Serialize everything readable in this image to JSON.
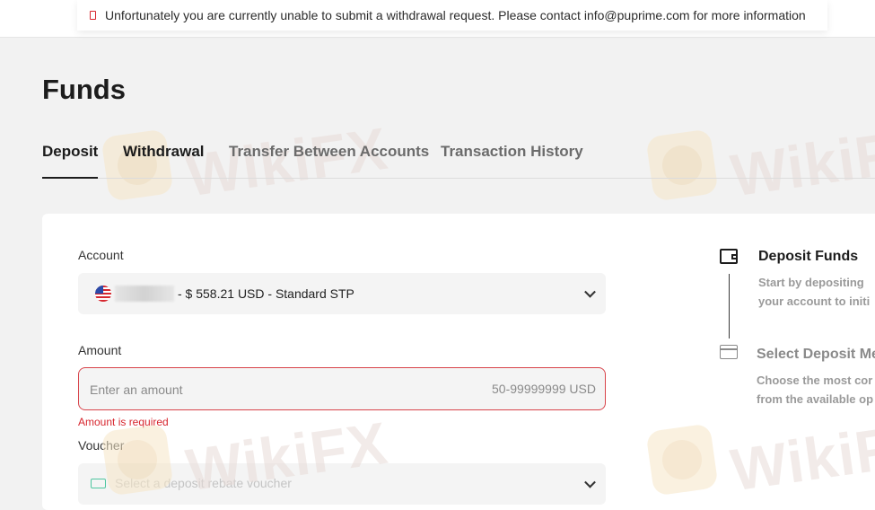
{
  "alert": {
    "message": "Unfortunately you are currently unable to submit a withdrawal request. Please contact info@puprime.com for more information",
    "icon": "alert-icon",
    "color": "#d7262e"
  },
  "page": {
    "title": "Funds"
  },
  "tabs": [
    {
      "label": "Deposit",
      "active": true
    },
    {
      "label": "Withdrawal",
      "active": false
    },
    {
      "label": "Transfer Between Accounts",
      "active": false
    },
    {
      "label": "Transaction History",
      "active": false
    }
  ],
  "form": {
    "account_label": "Account",
    "account_value": "- $ 558.21 USD - Standard STP",
    "amount_label": "Amount",
    "amount_placeholder": "Enter an amount",
    "amount_range": "50-99999999  USD",
    "amount_error": "Amount is required",
    "voucher_label": "Voucher",
    "voucher_placeholder": "Select a deposit rebate voucher"
  },
  "steps": [
    {
      "title": "Deposit Funds",
      "desc_line1": "Start by depositing",
      "desc_line2": "your account to initi",
      "icon": "wallet-icon"
    },
    {
      "title": "Select Deposit Me",
      "desc_line1": "Choose the most cor",
      "desc_line2": "from the available op",
      "icon": "card-icon"
    }
  ],
  "watermark": {
    "text": "WikiFX"
  },
  "colors": {
    "error": "#d7262e",
    "background": "#f2f2f2",
    "accent_green": "#4fc6a0"
  }
}
